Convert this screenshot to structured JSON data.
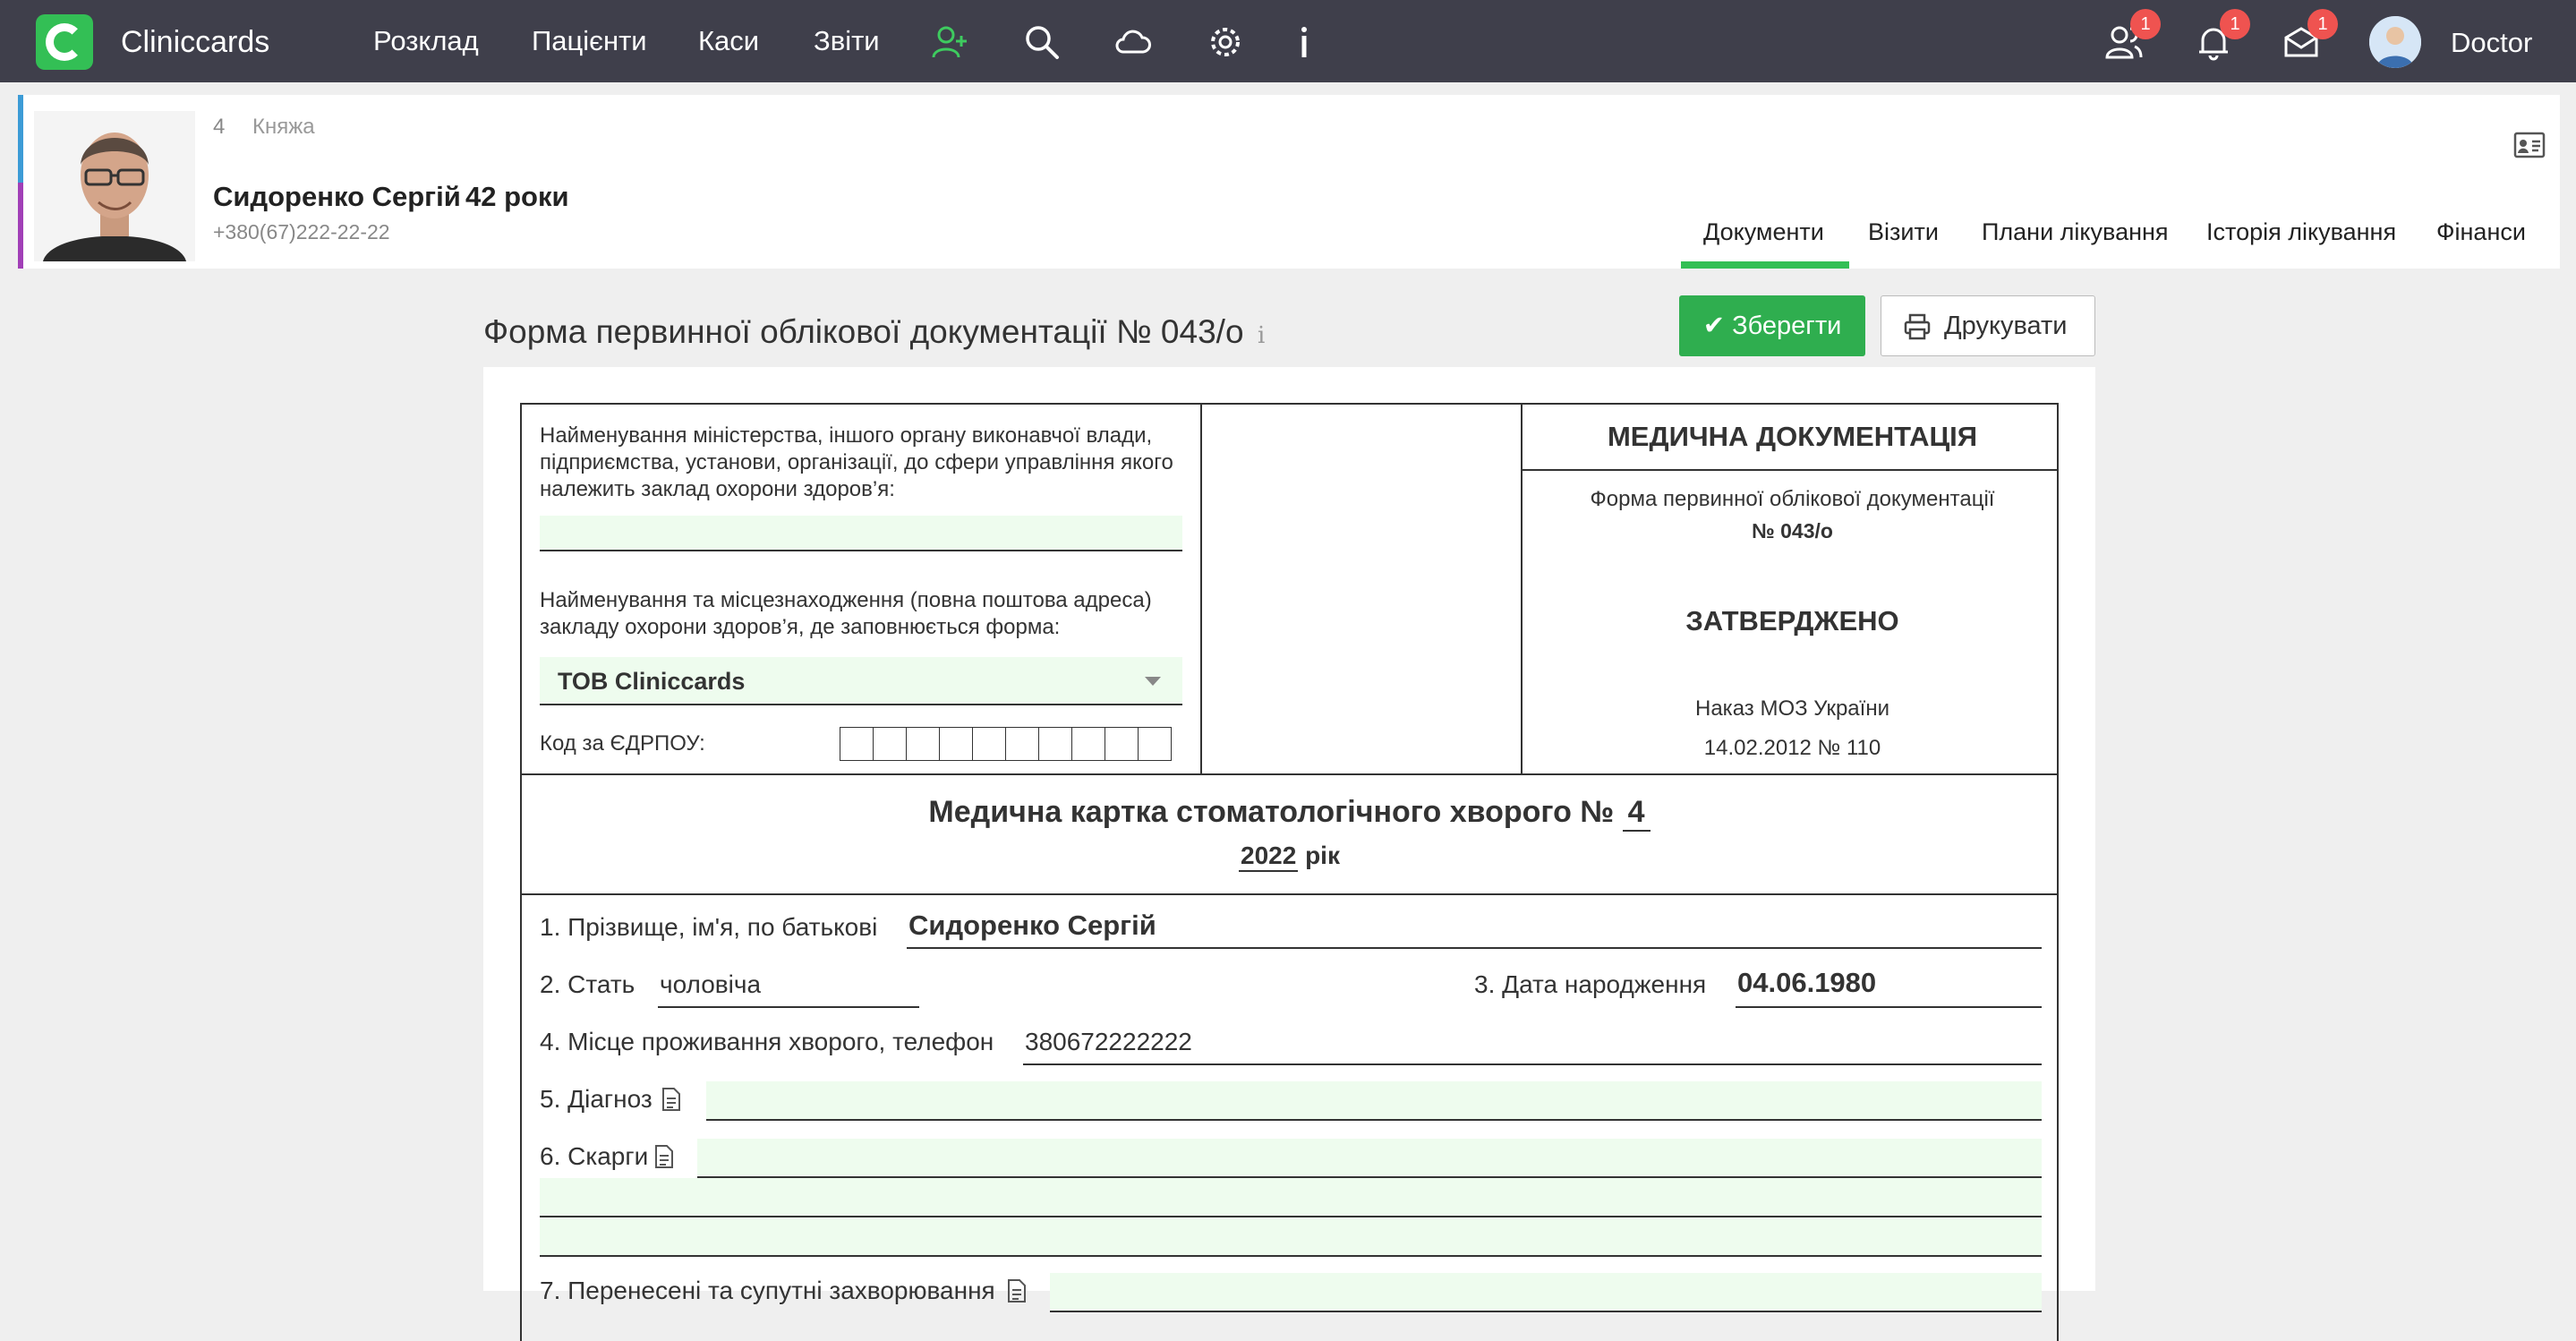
{
  "app": {
    "name": "Cliniccards",
    "user": "Doctor"
  },
  "nav": {
    "menu": [
      "Розклад",
      "Пацієнти",
      "Каси",
      "Звіти"
    ],
    "badges": {
      "users": "1",
      "notifications": "1",
      "messages": "1"
    }
  },
  "colors": {
    "accent": "#33bf55",
    "navbar": "#3f3f4b",
    "badge": "#ef5350"
  },
  "patient": {
    "card_number": "4",
    "city": "Княжа",
    "name": "Сидоренко Сергій",
    "age": "42 роки",
    "phone": "+380(67)222-22-22"
  },
  "tabs": [
    "Документи",
    "Візити",
    "Плани лікування",
    "Історія лікування",
    "Фінанси"
  ],
  "active_tab": "Документи",
  "form": {
    "title": "Форма первинної облікової документації № 043/о",
    "info_glyph": "i",
    "save_label": "Зберегти",
    "print_label": "Друкувати",
    "ministry_label": "Найменування міністерства, іншого органу виконавчої влади, підприємства, установи, організації, до сфери управління якого належить заклад охорони здоров’я:",
    "facility_label": "Найменування та місцезнаходження (повна поштова адреса) закладу охорони здоров’я, де заповнюється форма:",
    "facility_value": "ТОВ Cliniccards",
    "edrpou_label": "Код за ЄДРПОУ:",
    "right_title": "МЕДИЧНА ДОКУМЕНТАЦІЯ",
    "right_form_line1": "Форма первинної облікової документації",
    "right_form_line2": "№ 043/о",
    "approved": "ЗАТВЕРДЖЕНО",
    "order_line1": "Наказ МОЗ України",
    "order_line2": "14.02.2012 № 110",
    "card_title": "Медична картка стоматологічного хворого №",
    "card_number": "4",
    "year": "2022",
    "year_suffix": "рік",
    "fields": {
      "name_label": "1. Прізвище, ім'я, по батькові",
      "name_value": "Сидоренко Сергій",
      "sex_label": "2. Стать",
      "sex_value": "чоловіча",
      "dob_label": "3. Дата народження",
      "dob_value": "04.06.1980",
      "address_label": "4. Місце проживання хворого, телефон",
      "address_value": "380672222222",
      "diagnosis_label": "5. Діагноз",
      "complaints_label": "6. Скарги",
      "next_label": "7. Перенесені та супутні захворювання"
    }
  }
}
